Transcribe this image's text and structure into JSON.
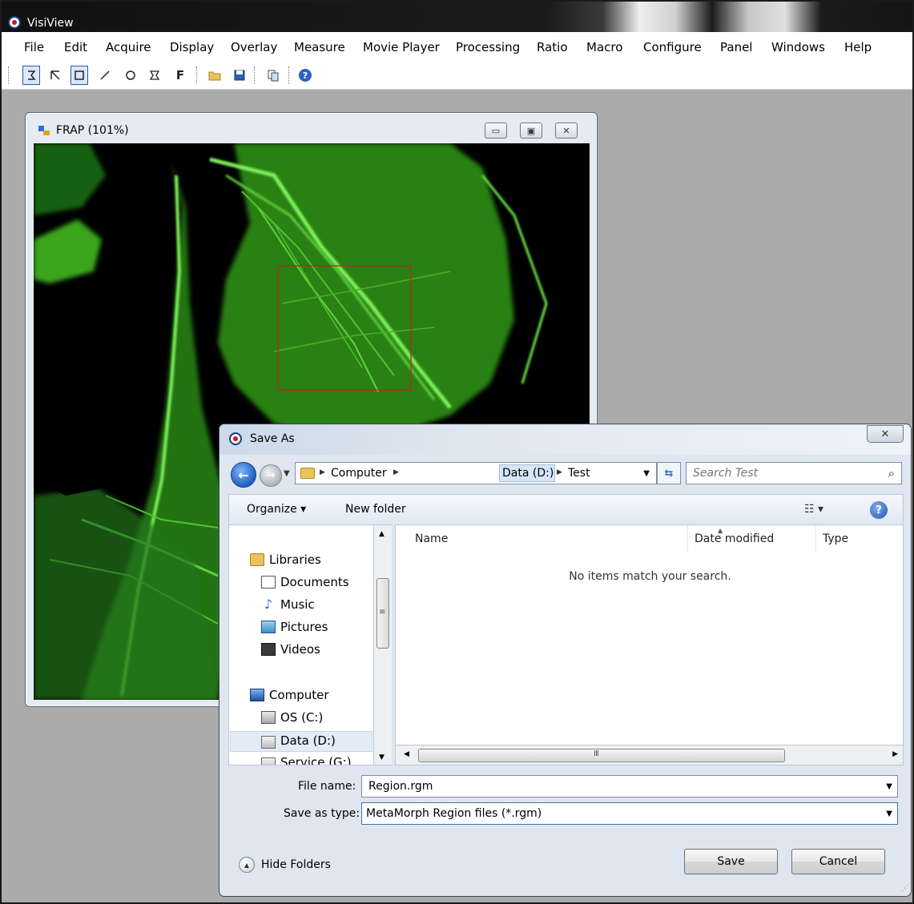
{
  "app": {
    "title": "VisiView"
  },
  "menu": [
    "File",
    "Edit",
    "Acquire",
    "Display",
    "Overlay",
    "Measure",
    "Movie Player",
    "Processing",
    "Ratio",
    "Macro",
    "Configure",
    "Panel",
    "Windows",
    "Help"
  ],
  "toolbar": {
    "text_tool_label": "F"
  },
  "image_window": {
    "title": "FRAP (101%)"
  },
  "dialog": {
    "title": "Save As",
    "breadcrumb": [
      "Computer",
      "Data (D:)",
      "Test"
    ],
    "search_placeholder": "Search Test",
    "organize_label": "Organize ▾",
    "new_folder_label": "New folder",
    "nav": {
      "libraries": "Libraries",
      "documents": "Documents",
      "music": "Music",
      "pictures": "Pictures",
      "videos": "Videos",
      "computer": "Computer",
      "os_c": "OS (C:)",
      "data_d": "Data (D:)",
      "service_g": "Service (G:)"
    },
    "columns": {
      "name": "Name",
      "date_modified": "Date modified",
      "type": "Type"
    },
    "empty_message": "No items match your search.",
    "file_name_label": "File name:",
    "file_name_value": "Region.rgm",
    "save_type_label": "Save as type:",
    "save_type_value": "MetaMorph Region files (*.rgm)",
    "hide_folders_label": "Hide Folders",
    "save_button": "Save",
    "cancel_button": "Cancel"
  }
}
